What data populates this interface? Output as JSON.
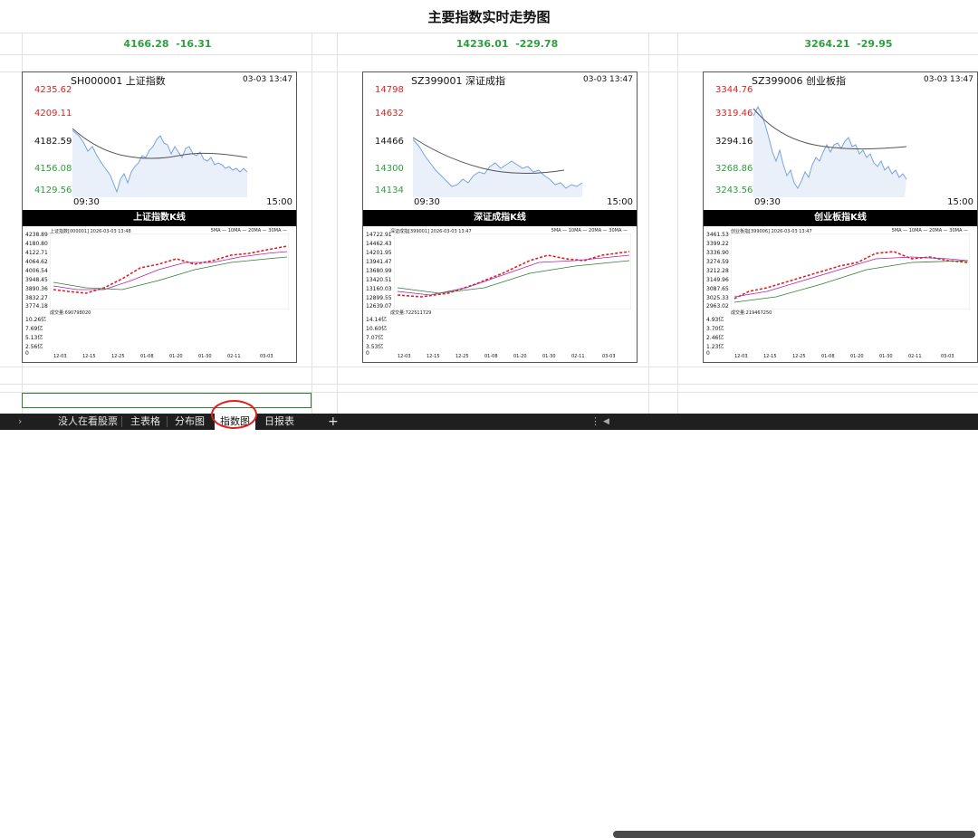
{
  "title": "主要指数实时走势图",
  "quotes": [
    {
      "price": "4166.28",
      "change": "-16.31"
    },
    {
      "price": "14236.01",
      "change": "-229.78"
    },
    {
      "price": "3264.21",
      "change": "-29.95"
    }
  ],
  "panels": [
    {
      "code": "SH000001 上证指数",
      "time": "03-03 13:47",
      "y_labels": [
        "4235.62",
        "4209.11",
        "4182.59",
        "4156.08",
        "4129.56"
      ],
      "x_start": "09:30",
      "x_end": "15:00",
      "kline_title": "上证指数K线",
      "kline_info": "上证指数[000001] 2026-03-03 13:48",
      "kline_ma": "5MA — 10MA — 20MA — 30MA —",
      "kline_y": [
        "4238.89",
        "4180.80",
        "4122.71",
        "4064.62",
        "4006.54",
        "3948.45",
        "3890.36",
        "3832.27",
        "3774.18"
      ],
      "volume_text": "成交量:690798020",
      "volume_y": [
        "10.26亿",
        "7.69亿",
        "5.13亿",
        "2.56亿",
        "0"
      ],
      "kline_x": [
        "12-03",
        "12-15",
        "12-25",
        "01-08",
        "01-20",
        "01-30",
        "02-11",
        "03-03"
      ]
    },
    {
      "code": "SZ399001 深证成指",
      "time": "03-03 13:47",
      "y_labels": [
        "14798",
        "14632",
        "14466",
        "14300",
        "14134"
      ],
      "x_start": "09:30",
      "x_end": "15:00",
      "kline_title": "深证成指K线",
      "kline_info": "深证成指[399001] 2026-03-03 13:47",
      "kline_ma": "5MA — 10MA — 20MA — 30MA —",
      "kline_y": [
        "14722.91",
        "14462.43",
        "14201.95",
        "13941.47",
        "13680.99",
        "13420.51",
        "13160.03",
        "12899.55",
        "12639.07"
      ],
      "volume_text": "成交量:722511729",
      "volume_y": [
        "14.14亿",
        "10.60亿",
        "7.07亿",
        "3.53亿",
        "0"
      ],
      "kline_x": [
        "12-03",
        "12-15",
        "12-25",
        "01-08",
        "01-20",
        "01-30",
        "02-11",
        "03-03"
      ]
    },
    {
      "code": "SZ399006 创业板指",
      "time": "03-03 13:47",
      "y_labels": [
        "3344.76",
        "3319.46",
        "3294.16",
        "3268.86",
        "3243.56"
      ],
      "x_start": "09:30",
      "x_end": "15:00",
      "kline_title": "创业板指K线",
      "kline_info": "创业板指[399006] 2026-03-03 13:47",
      "kline_ma": "5MA — 10MA — 20MA — 30MA —",
      "kline_y": [
        "3461.53",
        "3399.22",
        "3336.90",
        "3274.59",
        "3212.28",
        "3149.96",
        "3087.65",
        "3025.33",
        "2963.02"
      ],
      "volume_text": "成交量:219467250",
      "volume_y": [
        "4.93亿",
        "3.70亿",
        "2.46亿",
        "1.23亿",
        "0"
      ],
      "kline_x": [
        "12-03",
        "12-15",
        "12-25",
        "01-08",
        "01-20",
        "01-30",
        "02-11",
        "03-03"
      ]
    }
  ],
  "tabs": [
    {
      "label": "没人在看股票"
    },
    {
      "label": "主表格"
    },
    {
      "label": "分布图"
    },
    {
      "label": "指数图",
      "active": true
    },
    {
      "label": "日报表"
    },
    {
      "label": "+"
    }
  ],
  "colors": {
    "up": "#e02020",
    "down": "#2e9e3e",
    "neutral": "#111111"
  }
}
